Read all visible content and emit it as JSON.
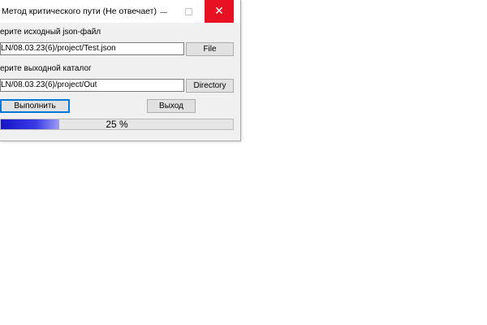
{
  "window": {
    "title": "Метод критического пути (Не отвечает)",
    "close_glyph": "✕"
  },
  "form": {
    "input_label": "ерите исходный json-файл",
    "input_path": "LN/08.03.23(6)/project/Test.json",
    "file_button": "File",
    "output_label": "ерите выходной каталог",
    "output_path": "LN/08.03.23(6)/project/Out",
    "directory_button": "Directory",
    "run_button": "Выполнить",
    "exit_button": "Выход"
  },
  "progress": {
    "value": 0.25,
    "text": "25 %"
  },
  "colors": {
    "close_button": "#e81123",
    "progress_fill": "#1616c8",
    "focus_border": "#0078d7"
  },
  "icons": {
    "minimize": "minimize-icon",
    "maximize": "maximize-icon",
    "close": "close-icon"
  }
}
